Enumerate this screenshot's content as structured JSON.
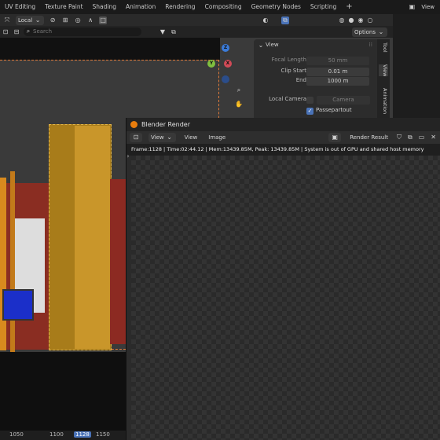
{
  "workspace_tabs": [
    "UV Editing",
    "Texture Paint",
    "Shading",
    "Animation",
    "Rendering",
    "Compositing",
    "Geometry Nodes",
    "Scripting",
    "+"
  ],
  "top_right": {
    "view_label": "View",
    "scene_icon": "scene-icon"
  },
  "viewport_header": {
    "orientation_value": "Local",
    "search_placeholder": "Search",
    "options_label": "Options"
  },
  "npanel": {
    "section_title": "View",
    "focal_length_label": "Focal Length",
    "focal_length_value": "50 mm",
    "clip_start_label": "Clip Start",
    "clip_start_value": "0.01 m",
    "end_label": "End",
    "end_value": "1000 m",
    "local_camera_label": "Local Camera",
    "camera_value": "Camera",
    "passepartout_label": "Passepartout",
    "passepartout_checked": true,
    "tabs": [
      "Tool",
      "View",
      "Animation"
    ]
  },
  "gizmo": {
    "z_label": "Z",
    "x_label": "X",
    "y_label": "Y"
  },
  "render_window": {
    "title": "Blender Render",
    "menu": [
      "View",
      "View",
      "Image"
    ],
    "result_label": "Render Result",
    "status": "Frame:1128 | Time:02:44.12 | Mem:13439.85M, Peak: 13439.85M | System is out of GPU and shared host memory"
  },
  "timeline": {
    "frames": [
      "1050",
      "1100",
      "1128",
      "1150"
    ],
    "current": "1128"
  },
  "colors": {
    "accent": "#4a73b8",
    "gizmo_x": "#d14a57",
    "gizmo_y": "#7fbf3f",
    "gizmo_z": "#3b7bd9"
  }
}
